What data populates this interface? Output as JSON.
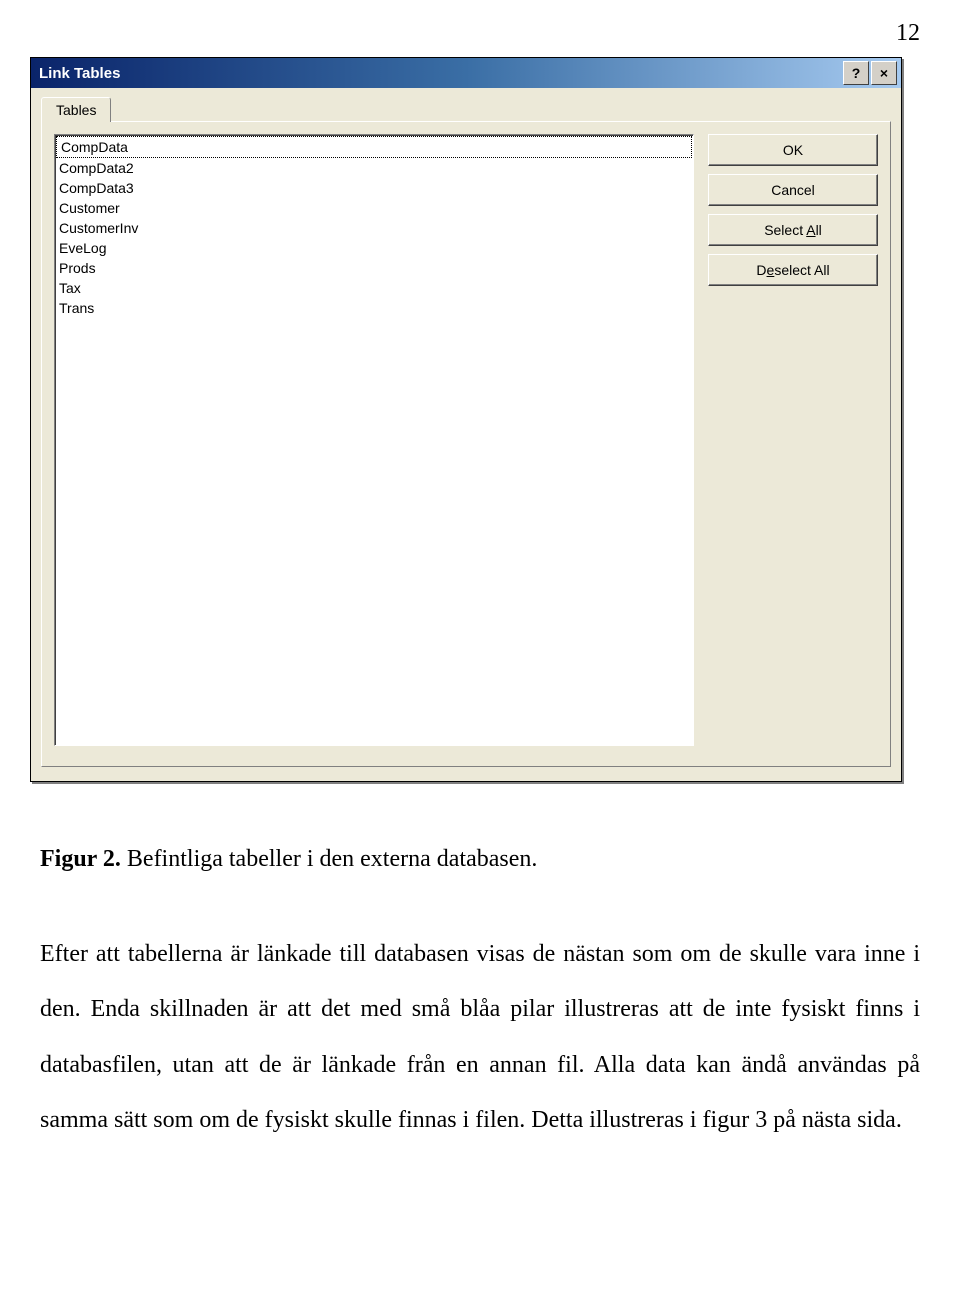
{
  "page_number": "12",
  "dialog": {
    "title": "Link Tables",
    "help_symbol": "?",
    "close_symbol": "×",
    "tab_label": "Tables",
    "list_items": [
      "CompData",
      "CompData2",
      "CompData3",
      "Customer",
      "CustomerInv",
      "EveLog",
      "Prods",
      "Tax",
      "Trans"
    ],
    "buttons": {
      "ok": "OK",
      "cancel": "Cancel",
      "select_all": "Select All",
      "deselect_all": "Deselect All"
    }
  },
  "figure": {
    "label": "Figur 2.",
    "caption": " Befintliga tabeller i den externa databasen."
  },
  "paragraph": "Efter att tabellerna är länkade till databasen visas de nästan som om de skulle vara inne i den. Enda skillnaden är att det med små blåa pilar illustreras att de inte fysiskt finns i databasfilen, utan att de är länkade från en annan fil. Alla data kan ändå användas på samma sätt som om de fysiskt skulle finnas i filen. Detta illustreras i figur 3 på nästa sida."
}
